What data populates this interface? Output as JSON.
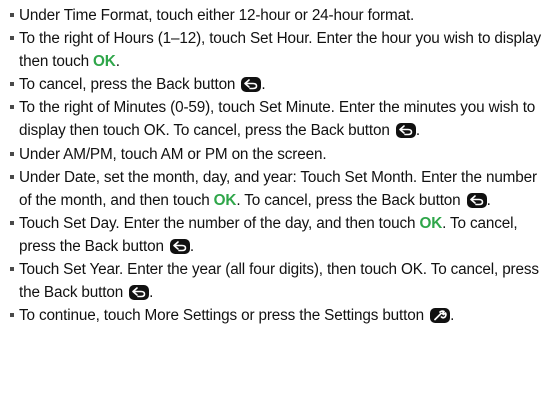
{
  "instructions": {
    "items": [
      {
        "parts": [
          {
            "t": "Under Time Format, touch either 12-hour or 24-hour format."
          }
        ]
      },
      {
        "parts": [
          {
            "t": "To the right of Hours (1–12), touch Set Hour. Enter the hour you wish to display then touch "
          },
          {
            "t": "OK",
            "ok": true
          },
          {
            "t": "."
          }
        ]
      },
      {
        "parts": [
          {
            "t": "To cancel, press the Back button "
          },
          {
            "icon": "back-icon"
          },
          {
            "t": "."
          }
        ]
      },
      {
        "parts": [
          {
            "t": "To the right of Minutes (0-59), touch Set Minute. Enter the minutes you wish to display then touch OK. To cancel,  press the Back button "
          },
          {
            "icon": "back-icon"
          },
          {
            "t": "."
          }
        ]
      },
      {
        "parts": [
          {
            "t": "Under AM/PM, touch AM or PM on the screen."
          }
        ]
      },
      {
        "parts": [
          {
            "t": "Under Date, set the month, day, and year: Touch Set Month. Enter the number of the month, and then touch "
          },
          {
            "t": "OK",
            "ok": true
          },
          {
            "t": ". To cancel, press the Back button "
          },
          {
            "icon": "back-icon"
          },
          {
            "t": "."
          }
        ]
      },
      {
        "parts": [
          {
            "t": "Touch Set Day. Enter the number of the day, and then touch "
          },
          {
            "t": "OK",
            "ok": true
          },
          {
            "t": ". To cancel, press the Back button "
          },
          {
            "icon": "back-icon"
          },
          {
            "t": "."
          }
        ]
      },
      {
        "parts": [
          {
            "t": "Touch Set Year. Enter the year (all four digits), then touch OK. To cancel, press the Back button "
          },
          {
            "icon": "back-icon"
          },
          {
            "t": "."
          }
        ]
      },
      {
        "parts": [
          {
            "t": "To continue, touch More Settings or press the Settings button "
          },
          {
            "icon": "settings-icon"
          },
          {
            "t": "."
          }
        ]
      }
    ]
  },
  "colors": {
    "ok_green": "#2fa64a",
    "text": "#111111",
    "icon_bg": "#111111"
  }
}
